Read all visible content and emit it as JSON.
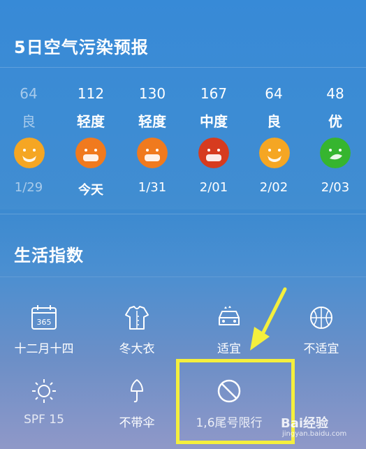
{
  "section_aqi": {
    "title": "5日空气污染预报",
    "days": [
      {
        "value": "64",
        "level": "良",
        "date": "1/29",
        "color": "#f5a623",
        "past": true
      },
      {
        "value": "112",
        "level": "轻度",
        "date": "今天",
        "color": "#f07a1e",
        "past": false
      },
      {
        "value": "130",
        "level": "轻度",
        "date": "1/31",
        "color": "#f07a1e",
        "past": false
      },
      {
        "value": "167",
        "level": "中度",
        "date": "2/01",
        "color": "#d63b1f",
        "past": false
      },
      {
        "value": "64",
        "level": "良",
        "date": "2/02",
        "color": "#f5a623",
        "past": false
      },
      {
        "value": "48",
        "level": "优",
        "date": "2/03",
        "color": "#36b52f",
        "past": false
      }
    ]
  },
  "section_life": {
    "title": "生活指数",
    "items": [
      {
        "label": "十二月十四",
        "icon": "calendar-icon",
        "calendar_text": "365"
      },
      {
        "label": "冬大衣",
        "icon": "coat-icon"
      },
      {
        "label": "适宜",
        "icon": "car-wash-icon"
      },
      {
        "label": "不适宜",
        "icon": "basketball-icon"
      },
      {
        "label": "SPF 15",
        "icon": "sun-icon"
      },
      {
        "label": "不带伞",
        "icon": "umbrella-icon"
      },
      {
        "label": "1,6尾号限行",
        "icon": "no-entry-icon"
      }
    ]
  },
  "annotation": {
    "highlight_color": "#f4ef3d"
  },
  "watermark": {
    "brand": "Bai经验",
    "url": "jingyan.baidu.com"
  }
}
